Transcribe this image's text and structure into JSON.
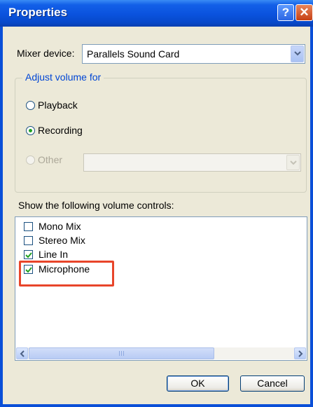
{
  "window": {
    "title": "Properties",
    "help_label": "?",
    "close_label": "✕"
  },
  "mixer": {
    "label": "Mixer device:",
    "selected": "Parallels Sound Card"
  },
  "adjust": {
    "group_label": "Adjust volume for",
    "options": [
      {
        "label": "Playback",
        "checked": false,
        "enabled": true
      },
      {
        "label": "Recording",
        "checked": true,
        "enabled": true
      },
      {
        "label": "Other",
        "checked": false,
        "enabled": false
      }
    ],
    "other_value": ""
  },
  "controls": {
    "label": "Show the following volume controls:",
    "items": [
      {
        "label": "Mono Mix",
        "checked": false
      },
      {
        "label": "Stereo Mix",
        "checked": false
      },
      {
        "label": "Line In",
        "checked": true
      },
      {
        "label": "Microphone",
        "checked": true
      }
    ]
  },
  "buttons": {
    "ok": "OK",
    "cancel": "Cancel"
  },
  "colors": {
    "title_bar": "#0a52dd",
    "dialog_bg": "#ece9d8",
    "group_title": "#0046d5",
    "highlight": "#e8452a",
    "check": "#21a121"
  },
  "icons": {
    "help": "question-icon",
    "close": "close-x-icon",
    "dropdown": "chevron-down-icon",
    "scroll_left": "arrow-left-icon",
    "scroll_right": "arrow-right-icon",
    "check": "checkmark-icon"
  }
}
